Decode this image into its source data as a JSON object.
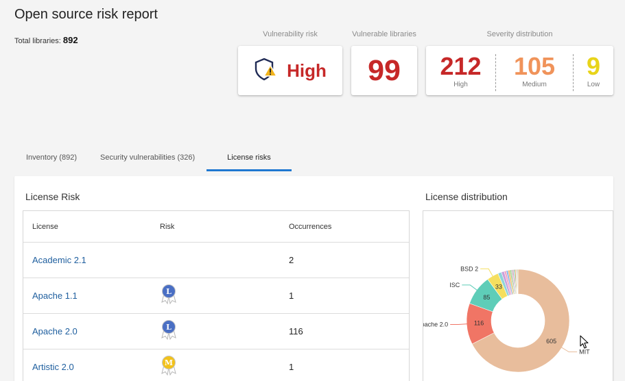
{
  "header": {
    "title": "Open source risk report",
    "total_label": "Total libraries:",
    "total_value": "892"
  },
  "cards": {
    "vulnerability_risk": {
      "label": "Vulnerability risk",
      "value": "High",
      "icon": "shield-warning-icon"
    },
    "vulnerable_libraries": {
      "label": "Vulnerable libraries",
      "value": "99"
    },
    "severity": {
      "label": "Severity distribution",
      "high": {
        "value": "212",
        "label": "High",
        "color": "#c62828"
      },
      "medium": {
        "value": "105",
        "label": "Medium",
        "color": "#f0935a"
      },
      "low": {
        "value": "9",
        "label": "Low",
        "color": "#e8d41a"
      }
    }
  },
  "tabs": [
    {
      "label": "Inventory (892)"
    },
    {
      "label": "Security vulnerabilities (326)"
    },
    {
      "label": "License risks",
      "active": true
    }
  ],
  "license_risk": {
    "title": "License Risk",
    "columns": [
      "License",
      "Risk",
      "Occurrences"
    ],
    "rows": [
      {
        "license": "Academic 2.1",
        "risk": "",
        "occurrences": "2"
      },
      {
        "license": "Apache 1.1",
        "risk": "L",
        "occurrences": "1"
      },
      {
        "license": "Apache 2.0",
        "risk": "L",
        "occurrences": "116"
      },
      {
        "license": "Artistic 2.0",
        "risk": "M",
        "occurrences": "1"
      }
    ]
  },
  "license_distribution": {
    "title": "License distribution",
    "segments": [
      {
        "name": "MIT",
        "value": 605,
        "label": "605",
        "color": "#e8bd9c"
      },
      {
        "name": "Apache 2.0",
        "value": 116,
        "label": "116",
        "color": "#f07565"
      },
      {
        "name": "ISC",
        "value": 85,
        "label": "85",
        "color": "#5ecdb8"
      },
      {
        "name": "BSD 2",
        "value": 33,
        "label": "33",
        "color": "#f5df5e"
      },
      {
        "name": "",
        "value": 10,
        "label": "",
        "color": "#8fd4d9"
      },
      {
        "name": "",
        "value": 8,
        "label": "",
        "color": "#c9a0dc"
      },
      {
        "name": "",
        "value": 6,
        "label": "",
        "color": "#f3a6c4"
      },
      {
        "name": "",
        "value": 5,
        "label": "",
        "color": "#7fb3e6"
      },
      {
        "name": "",
        "value": 5,
        "label": "",
        "color": "#f6b86a"
      },
      {
        "name": "",
        "value": 4,
        "label": "",
        "color": "#9ad07a"
      },
      {
        "name": "",
        "value": 4,
        "label": "",
        "color": "#b8b8b8"
      },
      {
        "name": "",
        "value": 3,
        "label": "",
        "color": "#e48cb0"
      },
      {
        "name": "",
        "value": 3,
        "label": "",
        "color": "#6bc2a8"
      },
      {
        "name": "",
        "value": 3,
        "label": "",
        "color": "#d9a441"
      },
      {
        "name": "",
        "value": 2,
        "label": "",
        "color": "#8c9ed8"
      },
      {
        "name": "",
        "value": 2,
        "label": "",
        "color": "#e07b5c"
      },
      {
        "name": "",
        "value": 2,
        "label": "",
        "color": "#a3c95b"
      }
    ]
  }
}
